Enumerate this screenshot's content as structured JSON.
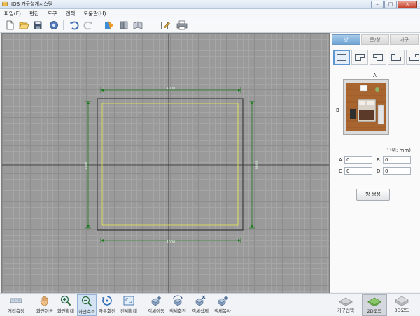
{
  "window": {
    "title": "IOS 가구설계시스템",
    "controls": [
      "–",
      "□",
      "×"
    ]
  },
  "menu": [
    "파일(F)",
    "편집",
    "도구",
    "견적",
    "도움말(H)"
  ],
  "toolbar": {
    "buttons": [
      "new-file",
      "open-folder",
      "save",
      "settings",
      "undo",
      "redo",
      "paint",
      "book",
      "catalog",
      "edit-document",
      "print"
    ]
  },
  "canvas": {
    "dimensions": {
      "top": "4000",
      "bottom": "4000",
      "left": "4000",
      "right": "4000"
    }
  },
  "panel": {
    "tabs": [
      {
        "label": "방",
        "active": true
      },
      {
        "label": "문/창",
        "active": false
      },
      {
        "label": "가구",
        "active": false
      }
    ],
    "room_shapes": [
      "rectangle",
      "l-shape-1",
      "l-shape-2",
      "l-shape-3",
      "l-shape-4"
    ],
    "preview": {
      "label_a": "A",
      "label_b": "B"
    },
    "unit_label": "(단위: mm)",
    "fields": [
      {
        "label": "A",
        "value": "0"
      },
      {
        "label": "B",
        "value": "0"
      },
      {
        "label": "C",
        "value": "0"
      },
      {
        "label": "D",
        "value": "0"
      }
    ],
    "generate_button": "방 생성"
  },
  "bottom_tools": [
    {
      "label": "거리측정",
      "icon": "ruler-icon"
    },
    {
      "label": "화면이동",
      "icon": "hand-icon"
    },
    {
      "label": "화면확대",
      "icon": "zoom-in-icon"
    },
    {
      "label": "화면축소",
      "icon": "zoom-out-icon",
      "active": true
    },
    {
      "label": "자유회전",
      "icon": "rotate-icon"
    },
    {
      "label": "전체확대",
      "icon": "fit-screen-icon"
    },
    {
      "label": "객체이동",
      "icon": "move-object-icon"
    },
    {
      "label": "객체회전",
      "icon": "rotate-object-icon"
    },
    {
      "label": "객체삭제",
      "icon": "delete-object-icon"
    },
    {
      "label": "객체복사",
      "icon": "copy-object-icon"
    }
  ],
  "modes": [
    {
      "label": "가구선택",
      "icon": "furniture-select-icon"
    },
    {
      "label": "2D모드",
      "icon": "2d-mode-icon",
      "active": true
    },
    {
      "label": "3D모드",
      "icon": "3d-mode-icon"
    }
  ],
  "colors": {
    "canvas_bg": "#9a9a9a",
    "wall": "#3a3a3a",
    "inner_line": "#e6e84a",
    "dimension": "#1f7a1f",
    "tab_active": "#6fa5d4"
  }
}
